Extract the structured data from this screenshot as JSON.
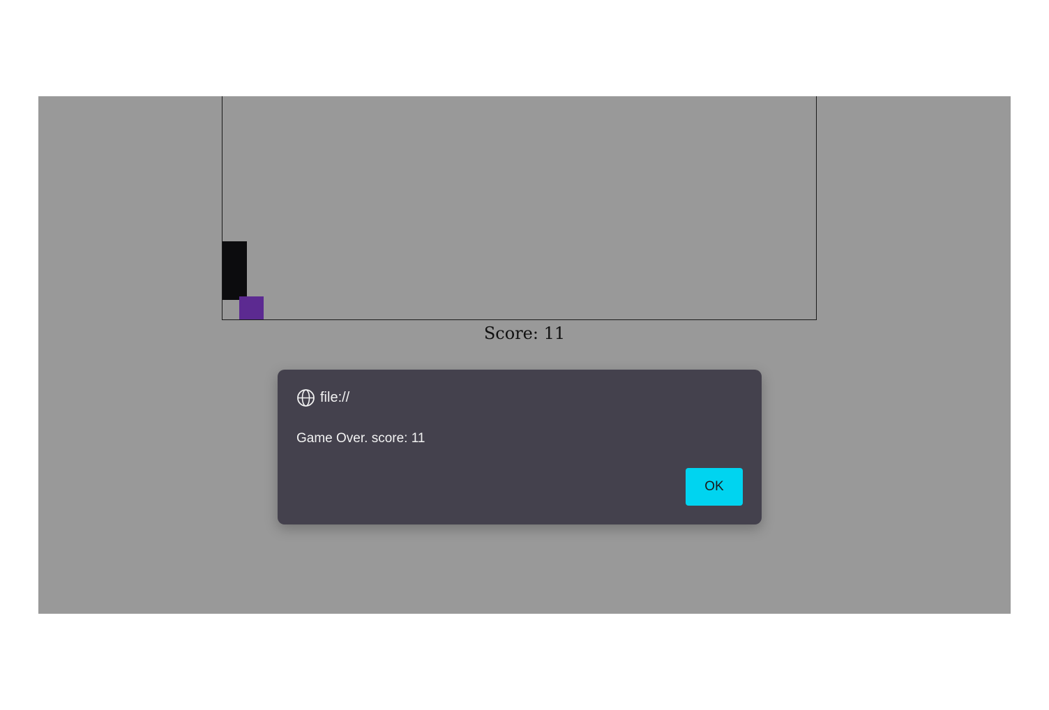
{
  "game": {
    "score_label": "Score: 11",
    "colors": {
      "background": "#999999",
      "obstacle": "#0c0c0e",
      "player": "#5c2a91"
    }
  },
  "dialog": {
    "origin": "file://",
    "origin_icon": "globe-icon",
    "message": "Game Over. score: 11",
    "ok_label": "OK",
    "button_color": "#00d4f0"
  }
}
